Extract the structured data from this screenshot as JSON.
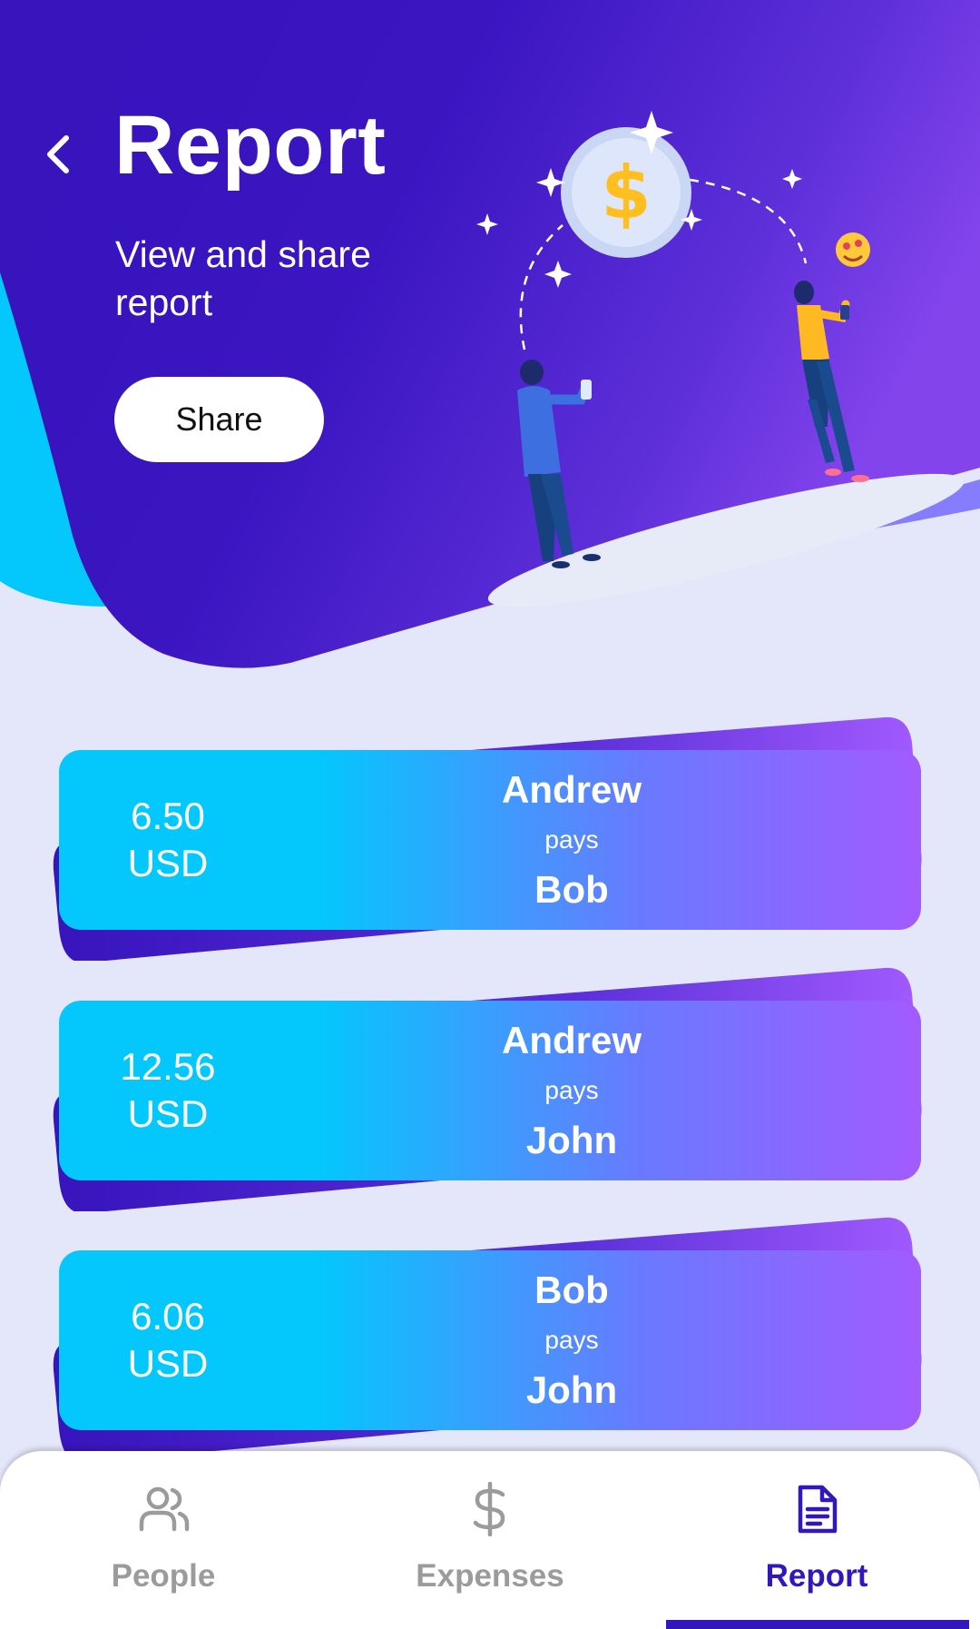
{
  "header": {
    "title": "Report",
    "subtitle": "View and share report",
    "share_label": "Share"
  },
  "colors": {
    "header_bg": "#3714bc",
    "accent_cyan": "#04c7fc",
    "accent_purple": "#a25bff",
    "page_bg": "#e4e6fa",
    "active_nav": "#3416bd",
    "inactive_nav": "#9b9b9b"
  },
  "report": {
    "items": [
      {
        "amount": "6.50",
        "currency": "USD",
        "payer": "Andrew",
        "verb": "pays",
        "payee": "Bob"
      },
      {
        "amount": "12.56",
        "currency": "USD",
        "payer": "Andrew",
        "verb": "pays",
        "payee": "John"
      },
      {
        "amount": "6.06",
        "currency": "USD",
        "payer": "Bob",
        "verb": "pays",
        "payee": "John"
      }
    ]
  },
  "nav": {
    "items": [
      {
        "label": "People",
        "icon": "people-icon",
        "active": false
      },
      {
        "label": "Expenses",
        "icon": "dollar-icon",
        "active": false
      },
      {
        "label": "Report",
        "icon": "document-icon",
        "active": true
      }
    ]
  }
}
